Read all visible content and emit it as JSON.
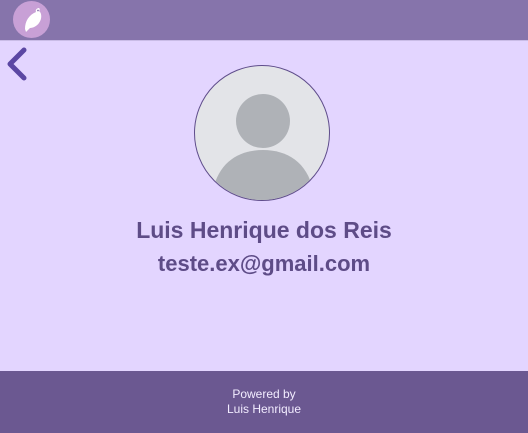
{
  "header": {
    "logo_icon": "bird-logo-icon"
  },
  "navigation": {
    "back_icon": "chevron-left-icon"
  },
  "profile": {
    "avatar_icon": "default-user-avatar-icon",
    "name": "Luis Henrique dos Reis",
    "email": "teste.ex@gmail.com"
  },
  "footer": {
    "line1": "Powered by",
    "line2": "Luis Henrique"
  },
  "colors": {
    "background": "#e3d5ff",
    "header": "#8674ab",
    "footer": "#6b5891",
    "text_primary": "#5e4c87",
    "accent": "#5f4d8b"
  }
}
